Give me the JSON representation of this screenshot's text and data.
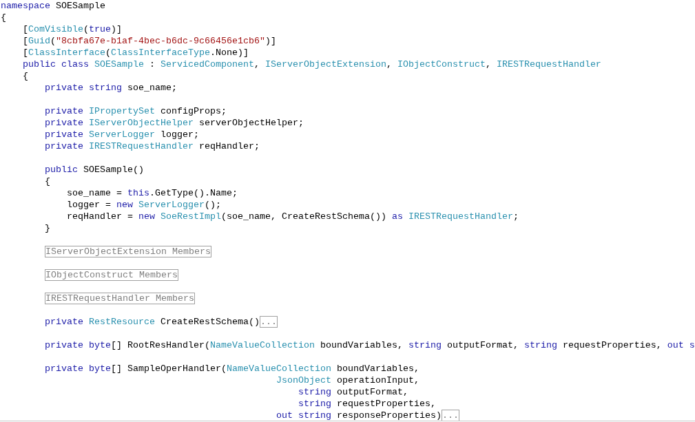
{
  "editor": {
    "lines": [
      {
        "kind": "code",
        "tokens": [
          {
            "kind": "keyword",
            "text": "namespace"
          },
          {
            "kind": "plain",
            "text": " SOESample"
          }
        ]
      },
      {
        "kind": "code",
        "tokens": [
          {
            "kind": "plain",
            "text": "{"
          }
        ]
      },
      {
        "kind": "code",
        "tokens": [
          {
            "kind": "plain",
            "text": "    ["
          },
          {
            "kind": "type",
            "text": "ComVisible"
          },
          {
            "kind": "plain",
            "text": "("
          },
          {
            "kind": "keyword",
            "text": "true"
          },
          {
            "kind": "plain",
            "text": ")]"
          }
        ]
      },
      {
        "kind": "code",
        "tokens": [
          {
            "kind": "plain",
            "text": "    ["
          },
          {
            "kind": "type",
            "text": "Guid"
          },
          {
            "kind": "plain",
            "text": "("
          },
          {
            "kind": "string",
            "text": "\"8cbfa67e-b1af-4bec-b6dc-9c66456e1cb6\""
          },
          {
            "kind": "plain",
            "text": ")]"
          }
        ]
      },
      {
        "kind": "code",
        "tokens": [
          {
            "kind": "plain",
            "text": "    ["
          },
          {
            "kind": "type",
            "text": "ClassInterface"
          },
          {
            "kind": "plain",
            "text": "("
          },
          {
            "kind": "type",
            "text": "ClassInterfaceType"
          },
          {
            "kind": "plain",
            "text": ".None)]"
          }
        ]
      },
      {
        "kind": "code",
        "tokens": [
          {
            "kind": "keyword",
            "text": "    public class "
          },
          {
            "kind": "type",
            "text": "SOESample"
          },
          {
            "kind": "plain",
            "text": " : "
          },
          {
            "kind": "type",
            "text": "ServicedComponent"
          },
          {
            "kind": "plain",
            "text": ", "
          },
          {
            "kind": "type",
            "text": "IServerObjectExtension"
          },
          {
            "kind": "plain",
            "text": ", "
          },
          {
            "kind": "type",
            "text": "IObjectConstruct"
          },
          {
            "kind": "plain",
            "text": ", "
          },
          {
            "kind": "type",
            "text": "IRESTRequestHandler"
          }
        ]
      },
      {
        "kind": "code",
        "tokens": [
          {
            "kind": "plain",
            "text": "    {"
          }
        ]
      },
      {
        "kind": "code",
        "tokens": [
          {
            "kind": "keyword",
            "text": "        private string"
          },
          {
            "kind": "plain",
            "text": " soe_name;"
          }
        ]
      },
      {
        "kind": "blank"
      },
      {
        "kind": "code",
        "tokens": [
          {
            "kind": "keyword",
            "text": "        private "
          },
          {
            "kind": "type",
            "text": "IPropertySet"
          },
          {
            "kind": "plain",
            "text": " configProps;"
          }
        ]
      },
      {
        "kind": "code",
        "tokens": [
          {
            "kind": "keyword",
            "text": "        private "
          },
          {
            "kind": "type",
            "text": "IServerObjectHelper"
          },
          {
            "kind": "plain",
            "text": " serverObjectHelper;"
          }
        ]
      },
      {
        "kind": "code",
        "tokens": [
          {
            "kind": "keyword",
            "text": "        private "
          },
          {
            "kind": "type",
            "text": "ServerLogger"
          },
          {
            "kind": "plain",
            "text": " logger;"
          }
        ]
      },
      {
        "kind": "code",
        "tokens": [
          {
            "kind": "keyword",
            "text": "        private "
          },
          {
            "kind": "type",
            "text": "IRESTRequestHandler"
          },
          {
            "kind": "plain",
            "text": " reqHandler;"
          }
        ]
      },
      {
        "kind": "blank"
      },
      {
        "kind": "code",
        "tokens": [
          {
            "kind": "keyword",
            "text": "        public"
          },
          {
            "kind": "plain",
            "text": " SOESample()"
          }
        ]
      },
      {
        "kind": "code",
        "tokens": [
          {
            "kind": "plain",
            "text": "        {"
          }
        ]
      },
      {
        "kind": "code",
        "tokens": [
          {
            "kind": "plain",
            "text": "            soe_name = "
          },
          {
            "kind": "keyword",
            "text": "this"
          },
          {
            "kind": "plain",
            "text": ".GetType().Name;"
          }
        ]
      },
      {
        "kind": "code",
        "tokens": [
          {
            "kind": "plain",
            "text": "            logger = "
          },
          {
            "kind": "keyword",
            "text": "new "
          },
          {
            "kind": "type",
            "text": "ServerLogger"
          },
          {
            "kind": "plain",
            "text": "();"
          }
        ]
      },
      {
        "kind": "code",
        "tokens": [
          {
            "kind": "plain",
            "text": "            reqHandler = "
          },
          {
            "kind": "keyword",
            "text": "new "
          },
          {
            "kind": "type",
            "text": "SoeRestImpl"
          },
          {
            "kind": "plain",
            "text": "(soe_name, CreateRestSchema()) "
          },
          {
            "kind": "keyword",
            "text": "as "
          },
          {
            "kind": "type",
            "text": "IRESTRequestHandler"
          },
          {
            "kind": "plain",
            "text": ";"
          }
        ]
      },
      {
        "kind": "code",
        "tokens": [
          {
            "kind": "plain",
            "text": "        }"
          }
        ]
      },
      {
        "kind": "blank"
      },
      {
        "kind": "code",
        "tokens": [
          {
            "kind": "collapsed",
            "text": "        IServerObjectExtension Members"
          }
        ]
      },
      {
        "kind": "blank"
      },
      {
        "kind": "code",
        "tokens": [
          {
            "kind": "collapsed",
            "text": "        IObjectConstruct Members"
          }
        ]
      },
      {
        "kind": "blank"
      },
      {
        "kind": "code",
        "tokens": [
          {
            "kind": "collapsed",
            "text": "        IRESTRequestHandler Members"
          }
        ]
      },
      {
        "kind": "blank"
      },
      {
        "kind": "code",
        "tokens": [
          {
            "kind": "keyword",
            "text": "        private "
          },
          {
            "kind": "type",
            "text": "RestResource"
          },
          {
            "kind": "plain",
            "text": " CreateRestSchema()"
          },
          {
            "kind": "collapsed",
            "text": "..."
          }
        ]
      },
      {
        "kind": "blank"
      },
      {
        "kind": "code",
        "tokens": [
          {
            "kind": "keyword",
            "text": "        private byte"
          },
          {
            "kind": "plain",
            "text": "[] RootResHandler("
          },
          {
            "kind": "type",
            "text": "NameValueCollection"
          },
          {
            "kind": "plain",
            "text": " boundVariables, "
          },
          {
            "kind": "keyword",
            "text": "string"
          },
          {
            "kind": "plain",
            "text": " outputFormat, "
          },
          {
            "kind": "keyword",
            "text": "string"
          },
          {
            "kind": "plain",
            "text": " requestProperties, "
          },
          {
            "kind": "keyword",
            "text": "out s"
          }
        ]
      },
      {
        "kind": "blank"
      },
      {
        "kind": "code",
        "tokens": [
          {
            "kind": "keyword",
            "text": "        private byte"
          },
          {
            "kind": "plain",
            "text": "[] SampleOperHandler("
          },
          {
            "kind": "type",
            "text": "NameValueCollection"
          },
          {
            "kind": "plain",
            "text": " boundVariables,"
          }
        ]
      },
      {
        "kind": "code",
        "tokens": [
          {
            "kind": "type",
            "text": "                                                  JsonObject"
          },
          {
            "kind": "plain",
            "text": " operationInput,"
          }
        ]
      },
      {
        "kind": "code",
        "tokens": [
          {
            "kind": "keyword",
            "text": "                                                      string"
          },
          {
            "kind": "plain",
            "text": " outputFormat,"
          }
        ]
      },
      {
        "kind": "code",
        "tokens": [
          {
            "kind": "keyword",
            "text": "                                                      string"
          },
          {
            "kind": "plain",
            "text": " requestProperties,"
          }
        ]
      },
      {
        "kind": "code",
        "tokens": [
          {
            "kind": "keyword",
            "text": "                                                  out string"
          },
          {
            "kind": "plain",
            "text": " responseProperties)"
          },
          {
            "kind": "collapsed",
            "text": "..."
          }
        ]
      }
    ]
  }
}
